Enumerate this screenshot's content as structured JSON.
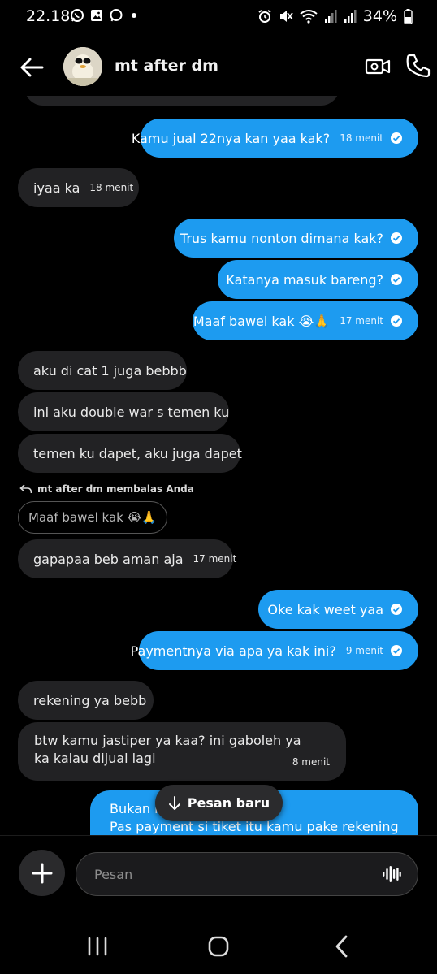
{
  "status_bar": {
    "time": "22.18",
    "battery": "34%",
    "left_icons": [
      "whatsapp-icon",
      "gallery-icon",
      "messages-icon",
      "dot-icon"
    ],
    "right_icons": [
      "alarm-icon",
      "mute-icon",
      "wifi-icon",
      "signal-icon",
      "signal-icon",
      "battery-icon"
    ]
  },
  "header": {
    "title": "mt after dm"
  },
  "messages": [
    {
      "dir": "out",
      "text": "Kamu jual 22nya kan yaa kak?",
      "time": "18 menit",
      "read": true
    },
    {
      "dir": "in",
      "text": "iyaa ka",
      "time": "18 menit"
    },
    {
      "dir": "out",
      "text": "Trus kamu nonton dimana kak?",
      "time": "",
      "read": true
    },
    {
      "dir": "out",
      "text": "Katanya masuk bareng?",
      "time": "",
      "read": true
    },
    {
      "dir": "out",
      "text": "Maaf bawel kak 😭🙏",
      "time": "17 menit",
      "read": true
    },
    {
      "dir": "in",
      "text": "aku di cat 1 juga bebbb",
      "time": ""
    },
    {
      "dir": "in",
      "text": "ini aku double war s temen ku",
      "time": ""
    },
    {
      "dir": "in",
      "text": "temen ku dapet, aku juga dapet",
      "time": ""
    },
    {
      "dir": "in",
      "text": "gapapaa beb aman aja",
      "time": "17 menit"
    },
    {
      "dir": "out",
      "text": "Oke kak weet yaa",
      "time": "",
      "read": true
    },
    {
      "dir": "out",
      "text": "Paymentnya via apa ya kak ini?",
      "time": "9 menit",
      "read": true
    },
    {
      "dir": "in",
      "text": "rekening ya bebb",
      "time": ""
    },
    {
      "dir": "in",
      "text": "btw kamu jastiper ya kaa? ini gaboleh ya ka kalau dijual lagi",
      "time": "8 menit"
    },
    {
      "dir": "out",
      "text_line1": "Bukan k",
      "text_line1_end": "k",
      "text_line2": "Pas payment si tiket itu kamu pake rekening apa"
    }
  ],
  "reply": {
    "label": "mt after dm membalas Anda",
    "quoted": "Maaf bawel kak 😭🙏"
  },
  "new_messages_pill": "Pesan baru",
  "composer": {
    "placeholder": "Pesan"
  },
  "colors": {
    "outgoing_bubble": "#1d9bf0",
    "incoming_bubble": "#222224",
    "background": "#000000"
  }
}
